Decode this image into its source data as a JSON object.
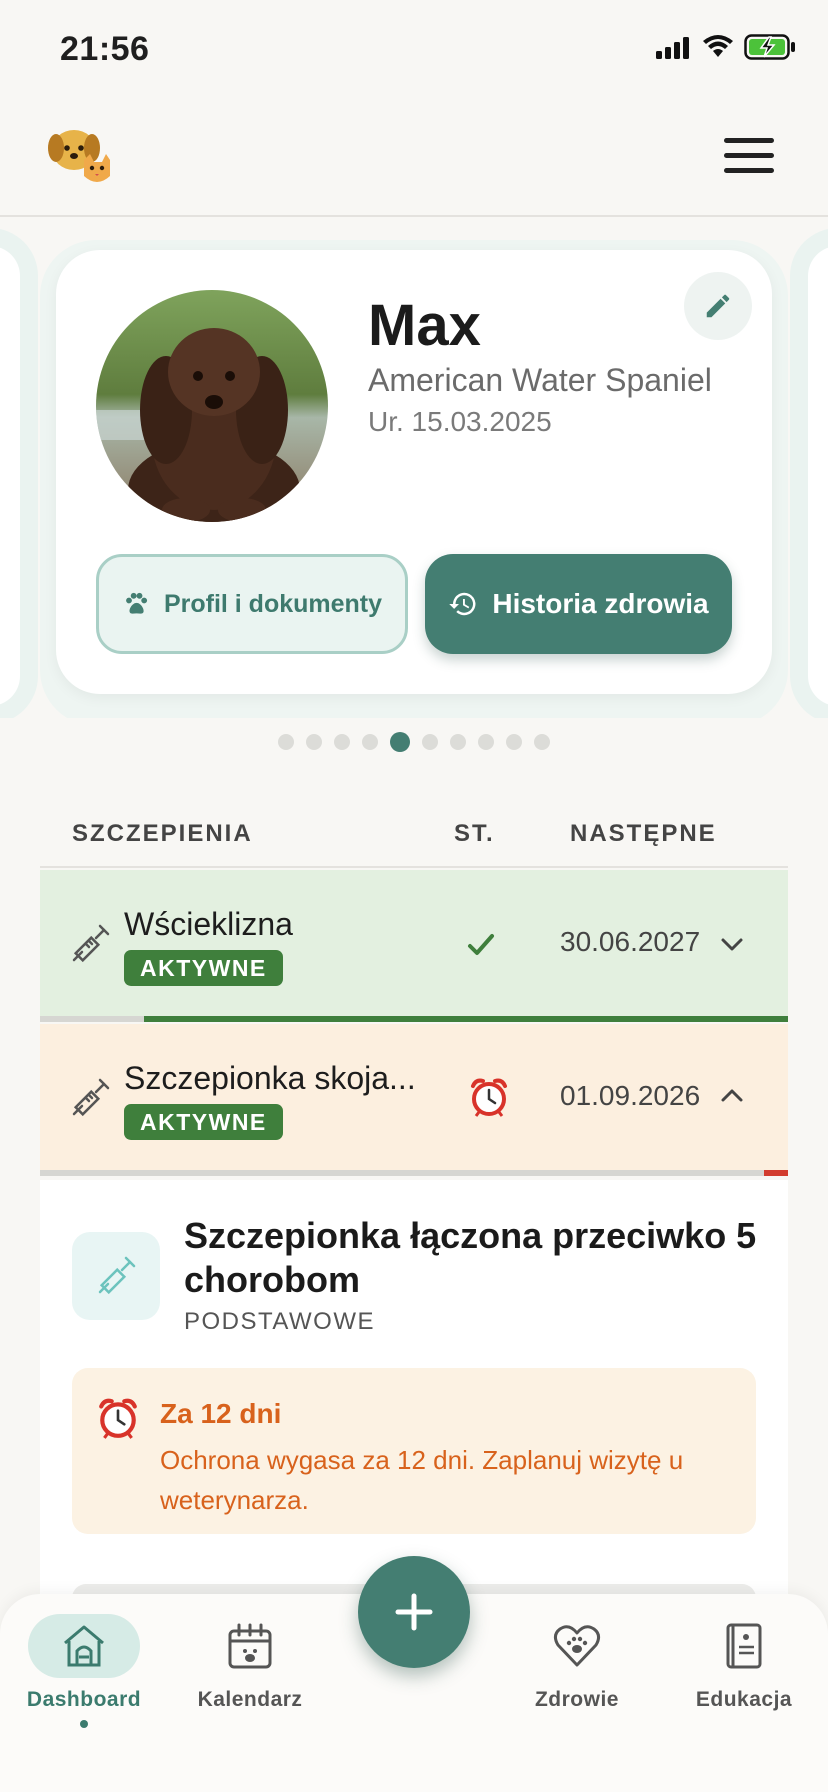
{
  "status_bar": {
    "time": "21:56",
    "icons": [
      "cellular-icon",
      "wifi-icon",
      "battery-charging-icon"
    ],
    "battery_color": "#4cc23a"
  },
  "header": {
    "logo": "pets-logo-icon",
    "menu_icon": "hamburger-menu-icon"
  },
  "pet": {
    "name": "Max",
    "breed": "American Water Spaniel",
    "dob": "Ur. 15.03.2025",
    "photo": "dog-photo",
    "profile_button": "Profil i dokumenty",
    "history_button": "Historia zdrowia",
    "carousel_total": 10,
    "carousel_index": 5
  },
  "vaccinations": {
    "headers": {
      "name": "SZCZEPIENIA",
      "status": "ST.",
      "next": "NASTĘPNE"
    },
    "rows": [
      {
        "name": "Wścieklizna",
        "badge": "AKTYWNE",
        "status_icon": "check-icon",
        "next_date": "30.06.2027",
        "expanded": false,
        "progress_fill_color": "#3f7f3c"
      },
      {
        "name": "Szczepionka skoja...",
        "badge": "AKTYWNE",
        "status_icon": "alarm-clock-icon",
        "next_date": "01.09.2026",
        "expanded": true,
        "progress_fill_color": "#d23c2f"
      }
    ],
    "detail": {
      "title": "Szczepionka łączona przeciwko 5 chorobom",
      "type": "PODSTAWOWE",
      "alert_title": "Za 12 dni",
      "alert_text": "Ochrona wygasa za 12 dni. Zaplanuj wizytę u weterynarza."
    }
  },
  "bottom_nav": {
    "items": [
      {
        "label": "Dashboard",
        "icon": "doghouse-icon",
        "active": true
      },
      {
        "label": "Kalendarz",
        "icon": "calendar-icon",
        "active": false
      },
      {
        "label": "Zdrowie",
        "icon": "heart-paw-icon",
        "active": false
      },
      {
        "label": "Edukacja",
        "icon": "book-icon",
        "active": false
      }
    ],
    "fab_icon": "plus-icon"
  },
  "colors": {
    "accent": "#447e72",
    "active_row_bg": "#e3f0e0",
    "warning_row_bg": "#fcefdf",
    "badge_green": "#3f7f3c",
    "alert_orange": "#d8621c"
  }
}
